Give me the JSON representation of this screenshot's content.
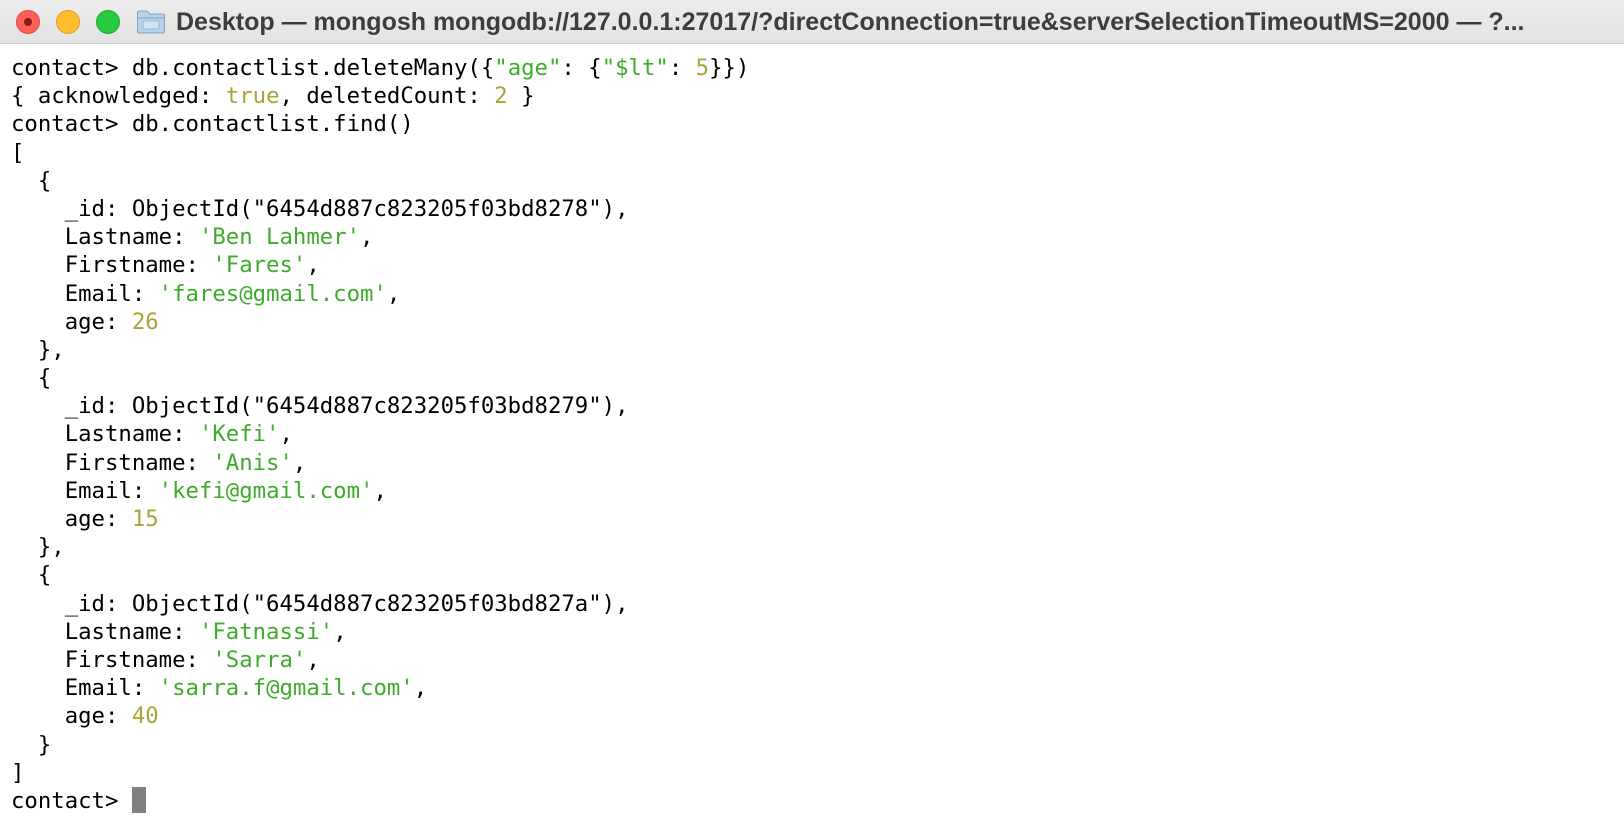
{
  "window": {
    "title": "Desktop — mongosh mongodb://127.0.0.1:27017/?directConnection=true&serverSelectionTimeoutMS=2000 — ?...",
    "icons": {
      "close": "close-icon",
      "minimize": "minimize-icon",
      "zoom": "zoom-icon",
      "folder": "folder-icon"
    }
  },
  "colors": {
    "string": "#3eab2c",
    "number": "#a9a437",
    "text": "#000000",
    "cursor": "#7f7f7f"
  },
  "terminal": {
    "prompt": "contact> ",
    "cmd1": {
      "pre": "db.contactlist.deleteMany({",
      "s1": "\"age\"",
      "mid": ": {",
      "s2": "\"$lt\"",
      "sep": ": ",
      "num": "5",
      "post": "}})"
    },
    "result": {
      "pre": "{ acknowledged: ",
      "bool": "true",
      "mid": ", deletedCount: ",
      "count": "2",
      "post": " }"
    },
    "cmd2": "db.contactlist.find()",
    "open_bracket": "[",
    "close_bracket": "]",
    "field_keys": {
      "id": "_id: ",
      "lastname": "Lastname: ",
      "firstname": "Firstname: ",
      "email": "Email: ",
      "age": "age: "
    },
    "documents": [
      {
        "id": "ObjectId(\"6454d887c823205f03bd8278\"),",
        "lastname": "'Ben Lahmer'",
        "firstname": "'Fares'",
        "email": "'fares@gmail.com'",
        "age": "26"
      },
      {
        "id": "ObjectId(\"6454d887c823205f03bd8279\"),",
        "lastname": "'Kefi'",
        "firstname": "'Anis'",
        "email": "'kefi@gmail.com'",
        "age": "15"
      },
      {
        "id": "ObjectId(\"6454d887c823205f03bd827a\"),",
        "lastname": "'Fatnassi'",
        "firstname": "'Sarra'",
        "email": "'sarra.f@gmail.com'",
        "age": "40"
      }
    ]
  }
}
